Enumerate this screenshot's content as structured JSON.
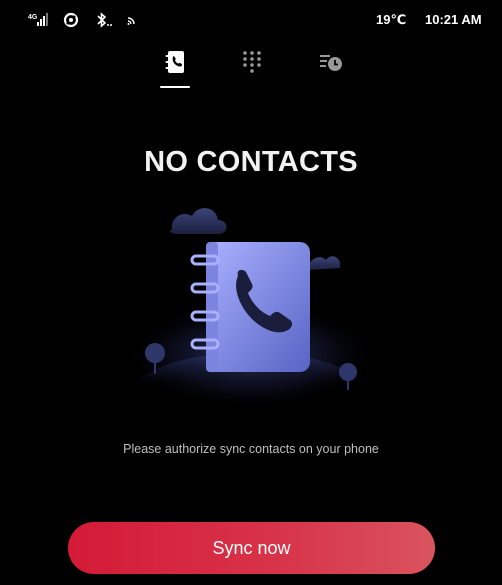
{
  "status": {
    "network": "4G",
    "temperature": "19℃",
    "time": "10:21 AM",
    "icons": [
      "signal-4g-icon",
      "data-sync-icon",
      "bluetooth-icon",
      "cast-icon"
    ]
  },
  "tabs": [
    {
      "icon": "contacts-book-icon",
      "active": true
    },
    {
      "icon": "dialpad-icon",
      "active": false
    },
    {
      "icon": "call-history-icon",
      "active": false
    }
  ],
  "main": {
    "title": "NO CONTACTS",
    "message": "Please authorize sync contacts on your phone",
    "illustration": "contacts-book-illustration"
  },
  "actions": {
    "sync_label": "Sync now",
    "accent_color": "#d41a36"
  }
}
